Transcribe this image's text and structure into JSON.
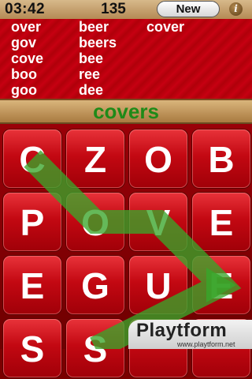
{
  "header": {
    "timer": "03:42",
    "score": "135",
    "new_button": "New",
    "info_icon": "i"
  },
  "found_words": [
    "over",
    "beer",
    "cover",
    "gov",
    "beers",
    "cove",
    "bee",
    "boo",
    "ree",
    "goo",
    "dee"
  ],
  "current_word": "covers",
  "board": {
    "tiles": [
      "C",
      "Z",
      "O",
      "B",
      "P",
      "O",
      "V",
      "E",
      "E",
      "G",
      "U",
      "E",
      "S",
      "S",
      "",
      ""
    ],
    "path_color": "#3aa52a",
    "tile_color": "#c30812",
    "current_word_color": "#1f8a18"
  },
  "watermark": {
    "title": "Playtform",
    "url": "www.playtform.net"
  }
}
